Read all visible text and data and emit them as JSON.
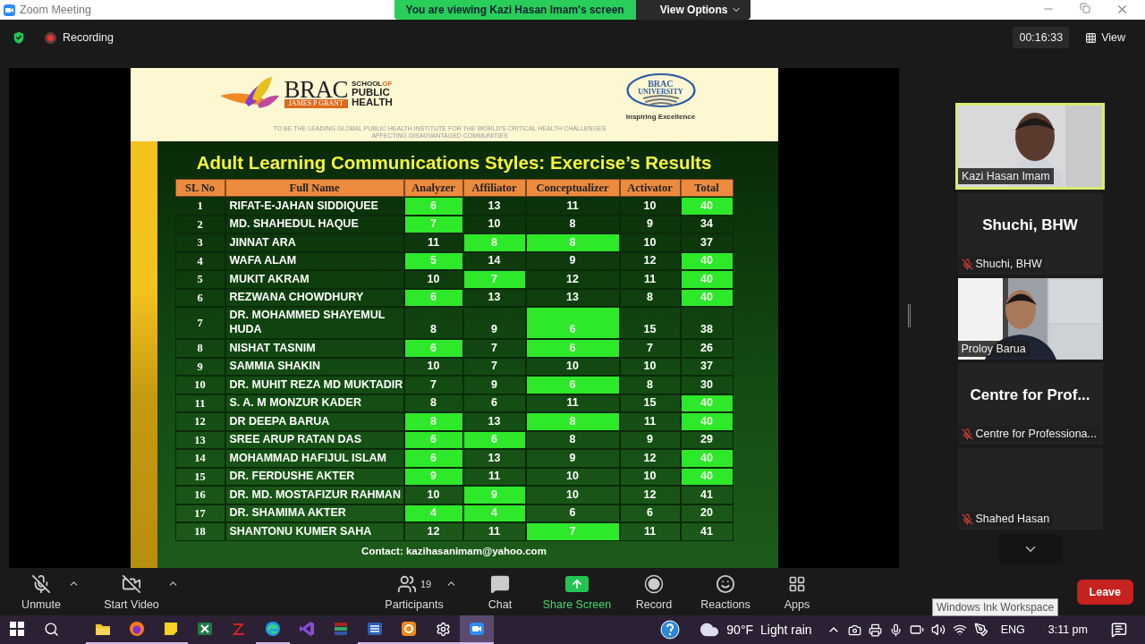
{
  "window": {
    "title": "Zoom Meeting"
  },
  "share_banner": {
    "text": "You are viewing Kazi Hasan Imam's screen",
    "options": "View Options"
  },
  "top_bar": {
    "recording": "Recording",
    "timer": "00:16:33",
    "view": "View"
  },
  "slide": {
    "logo_left": {
      "brand": "BRAC",
      "sub": "JAMES P GRANT",
      "school": "SCHOOL",
      "of": "OF",
      "line2": "PUBLIC",
      "line3": "HEALTH"
    },
    "logo_right": {
      "line1": "BRAC",
      "line2": "UNIVERSITY",
      "motto": "Inspiring Excellence"
    },
    "tagline": "TO BE THE LEADING GLOBAL PUBLIC HEALTH INSTITUTE FOR THE WORLD’S CRITICAL HEALTH CHALLENGES AFFECTING DISADVANTAGED COMMUNITIES",
    "title": "Adult Learning Communications Styles: Exercise’s Results",
    "table": {
      "columns": [
        "SL No",
        "Full Name",
        "Analyzer",
        "Affiliator",
        "Conceptualizer",
        "Activator",
        "Total"
      ],
      "rows": [
        {
          "cells": [
            {
              "value": "1",
              "highlighted": false
            },
            {
              "value": "RIFAT-E-JAHAN SIDDIQUEE",
              "highlighted": false
            },
            {
              "value": "6",
              "highlighted": true
            },
            {
              "value": "13",
              "highlighted": false
            },
            {
              "value": "11",
              "highlighted": false
            },
            {
              "value": "10",
              "highlighted": false
            },
            {
              "value": "40",
              "highlighted": true
            }
          ]
        },
        {
          "cells": [
            {
              "value": "2",
              "highlighted": false
            },
            {
              "value": "MD. SHAHEDUL HAQUE",
              "highlighted": false
            },
            {
              "value": "7",
              "highlighted": true
            },
            {
              "value": "10",
              "highlighted": false
            },
            {
              "value": "8",
              "highlighted": false
            },
            {
              "value": "9",
              "highlighted": false
            },
            {
              "value": "34",
              "highlighted": false
            }
          ]
        },
        {
          "cells": [
            {
              "value": "3",
              "highlighted": false
            },
            {
              "value": "JINNAT ARA",
              "highlighted": false
            },
            {
              "value": "11",
              "highlighted": false
            },
            {
              "value": "8",
              "highlighted": true
            },
            {
              "value": "8",
              "highlighted": true
            },
            {
              "value": "10",
              "highlighted": false
            },
            {
              "value": "37",
              "highlighted": false
            }
          ]
        },
        {
          "cells": [
            {
              "value": "4",
              "highlighted": false
            },
            {
              "value": "WAFA ALAM",
              "highlighted": false
            },
            {
              "value": "5",
              "highlighted": true
            },
            {
              "value": "14",
              "highlighted": false
            },
            {
              "value": "9",
              "highlighted": false
            },
            {
              "value": "12",
              "highlighted": false
            },
            {
              "value": "40",
              "highlighted": true
            }
          ]
        },
        {
          "cells": [
            {
              "value": "5",
              "highlighted": false
            },
            {
              "value": "MUKIT AKRAM",
              "highlighted": false
            },
            {
              "value": "10",
              "highlighted": false
            },
            {
              "value": "7",
              "highlighted": true
            },
            {
              "value": "12",
              "highlighted": false
            },
            {
              "value": "11",
              "highlighted": false
            },
            {
              "value": "40",
              "highlighted": true
            }
          ]
        },
        {
          "cells": [
            {
              "value": "6",
              "highlighted": false
            },
            {
              "value": "REZWANA CHOWDHURY",
              "highlighted": false
            },
            {
              "value": "6",
              "highlighted": true
            },
            {
              "value": "13",
              "highlighted": false
            },
            {
              "value": "13",
              "highlighted": false
            },
            {
              "value": "8",
              "highlighted": false
            },
            {
              "value": "40",
              "highlighted": true
            }
          ]
        },
        {
          "cells": [
            {
              "value": "7",
              "highlighted": false
            },
            {
              "value": "DR. MOHAMMED SHAYEMUL HUDA",
              "highlighted": false
            },
            {
              "value": "8",
              "highlighted": false
            },
            {
              "value": "9",
              "highlighted": false
            },
            {
              "value": "6",
              "highlighted": true
            },
            {
              "value": "15",
              "highlighted": false
            },
            {
              "value": "38",
              "highlighted": false
            }
          ]
        },
        {
          "cells": [
            {
              "value": "8",
              "highlighted": false
            },
            {
              "value": "NISHAT TASNIM",
              "highlighted": false
            },
            {
              "value": "6",
              "highlighted": true
            },
            {
              "value": "7",
              "highlighted": false
            },
            {
              "value": "6",
              "highlighted": true
            },
            {
              "value": "7",
              "highlighted": false
            },
            {
              "value": "26",
              "highlighted": false
            }
          ]
        },
        {
          "cells": [
            {
              "value": "9",
              "highlighted": false
            },
            {
              "value": "SAMMIA SHAKIN",
              "highlighted": false
            },
            {
              "value": "10",
              "highlighted": false
            },
            {
              "value": "7",
              "highlighted": false
            },
            {
              "value": "10",
              "highlighted": false
            },
            {
              "value": "10",
              "highlighted": false
            },
            {
              "value": "37",
              "highlighted": false
            }
          ]
        },
        {
          "cells": [
            {
              "value": "10",
              "highlighted": false
            },
            {
              "value": "DR. MUHIT REZA MD MUKTADIR",
              "highlighted": false
            },
            {
              "value": "7",
              "highlighted": false
            },
            {
              "value": "9",
              "highlighted": false
            },
            {
              "value": "6",
              "highlighted": true
            },
            {
              "value": "8",
              "highlighted": false
            },
            {
              "value": "30",
              "highlighted": false
            }
          ]
        },
        {
          "cells": [
            {
              "value": "11",
              "highlighted": false
            },
            {
              "value": "S. A. M MONZUR KADER",
              "highlighted": false
            },
            {
              "value": "8",
              "highlighted": false
            },
            {
              "value": "6",
              "highlighted": false
            },
            {
              "value": "11",
              "highlighted": false
            },
            {
              "value": "15",
              "highlighted": false
            },
            {
              "value": "40",
              "highlighted": true
            }
          ]
        },
        {
          "cells": [
            {
              "value": "12",
              "highlighted": false
            },
            {
              "value": "DR DEEPA BARUA",
              "highlighted": false
            },
            {
              "value": "8",
              "highlighted": true
            },
            {
              "value": "13",
              "highlighted": false
            },
            {
              "value": "8",
              "highlighted": true
            },
            {
              "value": "11",
              "highlighted": false
            },
            {
              "value": "40",
              "highlighted": true
            }
          ]
        },
        {
          "cells": [
            {
              "value": "13",
              "highlighted": false
            },
            {
              "value": "SREE ARUP RATAN DAS",
              "highlighted": false
            },
            {
              "value": "6",
              "highlighted": true
            },
            {
              "value": "6",
              "highlighted": true
            },
            {
              "value": "8",
              "highlighted": false
            },
            {
              "value": "9",
              "highlighted": false
            },
            {
              "value": "29",
              "highlighted": false
            }
          ]
        },
        {
          "cells": [
            {
              "value": "14",
              "highlighted": false
            },
            {
              "value": "MOHAMMAD HAFIJUL ISLAM",
              "highlighted": false
            },
            {
              "value": "6",
              "highlighted": true
            },
            {
              "value": "13",
              "highlighted": false
            },
            {
              "value": "9",
              "highlighted": false
            },
            {
              "value": "12",
              "highlighted": false
            },
            {
              "value": "40",
              "highlighted": true
            }
          ]
        },
        {
          "cells": [
            {
              "value": "15",
              "highlighted": false
            },
            {
              "value": "DR. FERDUSHE AKTER",
              "highlighted": false
            },
            {
              "value": "9",
              "highlighted": true
            },
            {
              "value": "11",
              "highlighted": false
            },
            {
              "value": "10",
              "highlighted": false
            },
            {
              "value": "10",
              "highlighted": false
            },
            {
              "value": "40",
              "highlighted": true
            }
          ]
        },
        {
          "cells": [
            {
              "value": "16",
              "highlighted": false
            },
            {
              "value": "DR. MD. MOSTAFIZUR RAHMAN",
              "highlighted": false
            },
            {
              "value": "10",
              "highlighted": false
            },
            {
              "value": "9",
              "highlighted": true
            },
            {
              "value": "10",
              "highlighted": false
            },
            {
              "value": "12",
              "highlighted": false
            },
            {
              "value": "41",
              "highlighted": false
            }
          ]
        },
        {
          "cells": [
            {
              "value": "17",
              "highlighted": false
            },
            {
              "value": "DR. SHAMIMA AKTER",
              "highlighted": false
            },
            {
              "value": "4",
              "highlighted": true
            },
            {
              "value": "4",
              "highlighted": true
            },
            {
              "value": "6",
              "highlighted": false
            },
            {
              "value": "6",
              "highlighted": false
            },
            {
              "value": "20",
              "highlighted": false
            }
          ]
        },
        {
          "cells": [
            {
              "value": "18",
              "highlighted": false
            },
            {
              "value": "SHANTONU KUMER SAHA",
              "highlighted": false
            },
            {
              "value": "12",
              "highlighted": false
            },
            {
              "value": "11",
              "highlighted": false
            },
            {
              "value": "7",
              "highlighted": true
            },
            {
              "value": "11",
              "highlighted": false
            },
            {
              "value": "41",
              "highlighted": false
            }
          ]
        }
      ]
    },
    "contact": "Contact: kazihasanimam@yahoo.com"
  },
  "participants": [
    {
      "kind": "video",
      "name": "Kazi Hasan Imam",
      "active_speaker": true,
      "muted": false
    },
    {
      "kind": "name",
      "display": "Shuchi, BHW",
      "name": "Shuchi, BHW",
      "active_speaker": false,
      "muted": true
    },
    {
      "kind": "video",
      "name": "Proloy Barua",
      "active_speaker": false,
      "muted": false
    },
    {
      "kind": "name",
      "display": "Centre for Prof...",
      "name": "Centre for Professiona...",
      "active_speaker": false,
      "muted": true
    },
    {
      "kind": "blank",
      "name": "Shahed Hasan",
      "active_speaker": false,
      "muted": true
    }
  ],
  "toolbar": {
    "left": [
      {
        "kind": "audio",
        "label": "Unmute",
        "off": true,
        "menu": true
      },
      {
        "kind": "video",
        "label": "Start Video",
        "off": true,
        "menu": true
      }
    ],
    "center": [
      {
        "kind": "participants",
        "label": "Participants",
        "count": "19",
        "menu": true
      },
      {
        "kind": "chat",
        "label": "Chat",
        "menu": false
      },
      {
        "kind": "share",
        "label": "Share Screen",
        "menu": false
      },
      {
        "kind": "record",
        "label": "Record",
        "menu": false
      },
      {
        "kind": "reactions",
        "label": "Reactions",
        "menu": false
      },
      {
        "kind": "apps",
        "label": "Apps",
        "menu": false
      }
    ],
    "leave": "Leave"
  },
  "tooltip": "Windows Ink Workspace",
  "taskbar": {
    "apps": [
      {
        "kind": "explorer",
        "open": true,
        "active": false
      },
      {
        "kind": "firefox",
        "open": true,
        "active": false
      },
      {
        "kind": "sticky",
        "open": true,
        "active": false
      },
      {
        "kind": "excel",
        "open": false,
        "active": false
      },
      {
        "kind": "zigzag",
        "open": false,
        "active": false
      },
      {
        "kind": "edge",
        "open": true,
        "active": false
      },
      {
        "kind": "studio",
        "open": false,
        "active": false
      },
      {
        "kind": "books",
        "open": false,
        "active": false
      },
      {
        "kind": "word",
        "open": true,
        "active": false
      },
      {
        "kind": "orange",
        "open": true,
        "active": false
      },
      {
        "kind": "settings",
        "open": true,
        "active": false
      },
      {
        "kind": "zoom",
        "open": true,
        "active": true
      }
    ],
    "temperature": "90°F",
    "weather": "Light rain",
    "language": "ENG",
    "time": "3:11 pm"
  }
}
